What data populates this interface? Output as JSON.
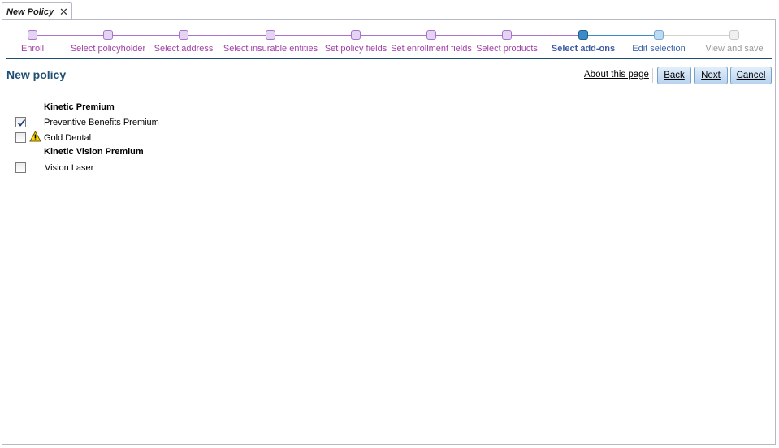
{
  "tab": {
    "title": "New Policy",
    "close_glyph": "✕"
  },
  "wizard": {
    "steps": [
      {
        "label": "Enroll",
        "state": "done"
      },
      {
        "label": "Select policyholder",
        "state": "done"
      },
      {
        "label": "Select address",
        "state": "done"
      },
      {
        "label": "Select insurable entities",
        "state": "done"
      },
      {
        "label": "Set policy fields",
        "state": "done"
      },
      {
        "label": "Set enrollment fields",
        "state": "done"
      },
      {
        "label": "Select products",
        "state": "done"
      },
      {
        "label": "Select add-ons",
        "state": "current"
      },
      {
        "label": "Edit selection",
        "state": "next"
      },
      {
        "label": "View and save",
        "state": "future"
      }
    ],
    "colors": {
      "done": "#a03fa6",
      "current": "#3d5aa6",
      "next": "#3c64a8",
      "future": "#999999"
    }
  },
  "page": {
    "title": "New policy",
    "about_link": "About this page",
    "buttons": {
      "back": "Back",
      "next": "Next",
      "cancel": "Cancel"
    }
  },
  "addons": {
    "groups": [
      {
        "title": "Kinetic Premium",
        "items": [
          {
            "label": "Preventive Benefits Premium",
            "checked": true,
            "warning": false
          },
          {
            "label": "Gold Dental",
            "checked": false,
            "warning": true
          }
        ]
      },
      {
        "title": "Kinetic Vision Premium",
        "items": [
          {
            "label": "Vision Laser",
            "checked": false,
            "warning": false
          }
        ]
      }
    ]
  },
  "icons": {
    "close": "close-icon",
    "check": "checkmark-icon",
    "warning": "warning-icon"
  }
}
